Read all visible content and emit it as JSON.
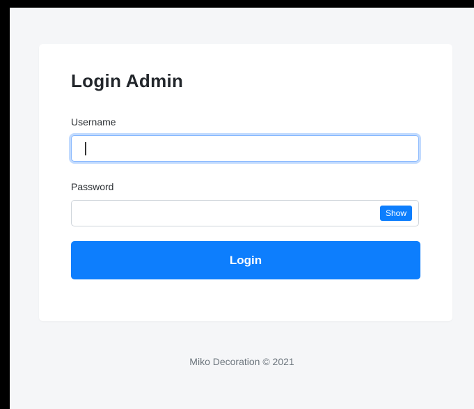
{
  "login": {
    "title": "Login Admin",
    "username_label": "Username",
    "username_value": "",
    "password_label": "Password",
    "password_value": "",
    "show_label": "Show",
    "submit_label": "Login"
  },
  "footer": {
    "text": "Miko Decoration © 2021"
  },
  "colors": {
    "primary": "#0d7efd",
    "page_background": "#f5f6f8",
    "focus_ring": "#86b7fe"
  }
}
